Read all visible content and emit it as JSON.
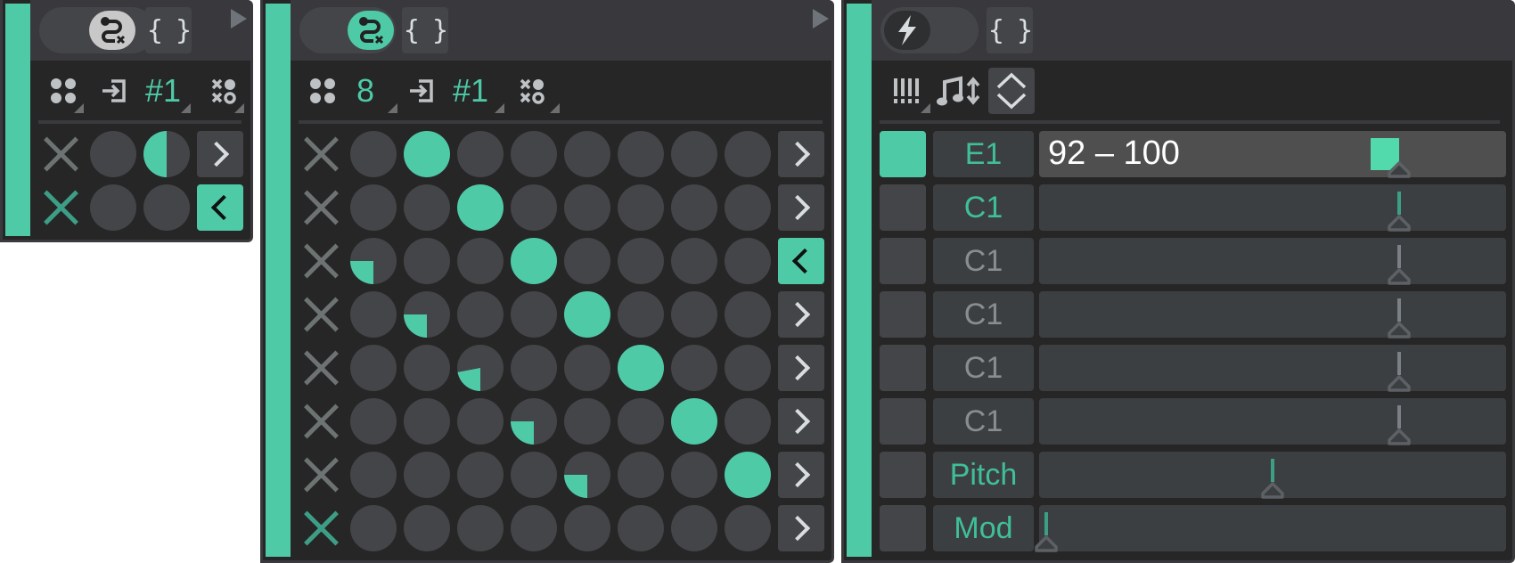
{
  "colors": {
    "accent": "#4ecaa7",
    "panel_bg": "#262626",
    "header_bg": "#39393d",
    "cell_bg": "#444548",
    "lane_bg": "#3c3f41",
    "muted_x": "#6d7372"
  },
  "panels": [
    {
      "name": "sequencer-small",
      "toggle": {
        "state": "on-neutral",
        "icon": "route-icon"
      },
      "braces_label": "{ }",
      "toolbar": {
        "grid_icon": "dots-grid-icon",
        "input_icon": "input-icon",
        "channel": "#1",
        "pattern_icon": "xo-pattern-icon"
      },
      "rows": [
        {
          "muted": false,
          "cells": [
            0,
            0.5
          ],
          "direction": "right"
        },
        {
          "muted": true,
          "cells": [
            0,
            0
          ],
          "direction": "left"
        }
      ]
    },
    {
      "name": "sequencer-large",
      "toggle": {
        "state": "on-accent",
        "icon": "route-icon"
      },
      "braces_label": "{ }",
      "toolbar": {
        "grid_icon": "dots-grid-icon",
        "steps": "8",
        "input_icon": "input-icon",
        "channel": "#1",
        "pattern_icon": "xo-pattern-icon"
      },
      "rows": [
        {
          "muted": false,
          "cells": [
            0,
            1,
            0,
            0,
            0,
            0,
            0,
            0
          ],
          "direction": "right"
        },
        {
          "muted": false,
          "cells": [
            0,
            0,
            1,
            0,
            0,
            0,
            0,
            0
          ],
          "direction": "right"
        },
        {
          "muted": false,
          "cells": [
            0.25,
            0,
            0,
            1,
            0,
            0,
            0,
            0
          ],
          "direction": "left"
        },
        {
          "muted": false,
          "cells": [
            0,
            0.25,
            0,
            0,
            1,
            0,
            0,
            0
          ],
          "direction": "right"
        },
        {
          "muted": false,
          "cells": [
            0,
            0,
            0.22,
            0,
            0,
            1,
            0,
            0
          ],
          "direction": "right"
        },
        {
          "muted": false,
          "cells": [
            0,
            0,
            0,
            0.25,
            0,
            0,
            1,
            0
          ],
          "direction": "right"
        },
        {
          "muted": false,
          "cells": [
            0,
            0,
            0,
            0,
            0.25,
            0,
            0,
            1
          ],
          "direction": "right"
        },
        {
          "muted": true,
          "cells": [
            0,
            0,
            0,
            0,
            0,
            0,
            0,
            0
          ],
          "direction": "right"
        }
      ]
    },
    {
      "name": "lane-editor",
      "toggle": {
        "state": "off",
        "icon": "lightning-icon"
      },
      "braces_label": "{ }",
      "toolbar": {
        "keys_icon": "piano-keys-icon",
        "note_icon": "note-transpose-icon",
        "updown_icon": "up-down-icon"
      },
      "lanes": [
        {
          "enabled": true,
          "label": "E1",
          "label_active": true,
          "range": "92 – 100",
          "value": 0.78,
          "marker_active": true,
          "selected": true
        },
        {
          "enabled": false,
          "label": "C1",
          "label_active": true,
          "range": "",
          "value": 0.78,
          "marker_active": true,
          "selected": false
        },
        {
          "enabled": false,
          "label": "C1",
          "label_active": false,
          "range": "",
          "value": 0.78,
          "marker_active": false,
          "selected": false
        },
        {
          "enabled": false,
          "label": "C1",
          "label_active": false,
          "range": "",
          "value": 0.78,
          "marker_active": false,
          "selected": false
        },
        {
          "enabled": false,
          "label": "C1",
          "label_active": false,
          "range": "",
          "value": 0.78,
          "marker_active": false,
          "selected": false
        },
        {
          "enabled": false,
          "label": "C1",
          "label_active": false,
          "range": "",
          "value": 0.78,
          "marker_active": false,
          "selected": false
        },
        {
          "enabled": false,
          "label": "Pitch",
          "label_active": true,
          "range": "",
          "value": 0.5,
          "marker_active": true,
          "selected": false
        },
        {
          "enabled": false,
          "label": "Mod",
          "label_active": true,
          "range": "",
          "value": 0.0,
          "marker_active": true,
          "selected": false
        }
      ]
    }
  ]
}
